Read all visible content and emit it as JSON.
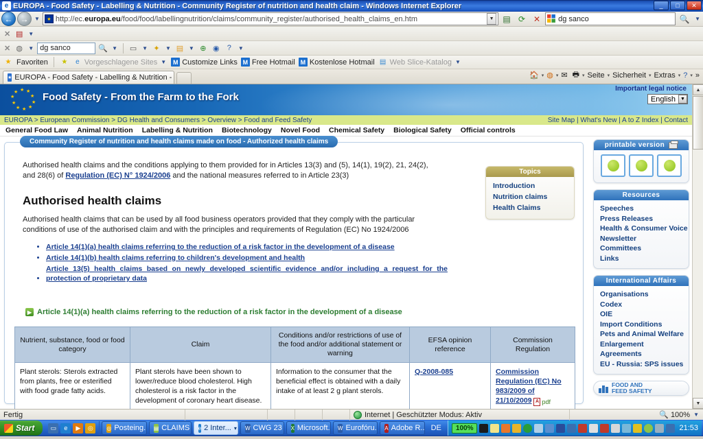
{
  "window": {
    "title": "EUROPA - Food Safety - Labelling & Nutrition - Community Register of nutrition and health claim - Windows Internet Explorer",
    "minimize": "_",
    "maximize": "□",
    "close": "✕"
  },
  "browser": {
    "url_prefix": "http://ec.",
    "url_bold": "europa.eu",
    "url_rest": "/food/food/labellingnutrition/claims/community_register/authorised_health_claims_en.htm",
    "search_value": "dg sanco",
    "toolbar_search_value": "dg sanco",
    "favorites_label": "Favoriten",
    "favorites": [
      {
        "label": "Vorgeschlagene Sites",
        "icon": "ie-icon",
        "dimmed": true
      },
      {
        "label": "Customize Links",
        "icon": "msn-icon",
        "dimmed": false
      },
      {
        "label": "Free Hotmail",
        "icon": "msn-icon",
        "dimmed": false
      },
      {
        "label": "Kostenlose Hotmail",
        "icon": "msn-icon",
        "dimmed": false
      },
      {
        "label": "Web Slice-Katalog",
        "icon": "webslice-icon",
        "dimmed": true
      }
    ],
    "tab_label": "EUROPA - Food Safety - Labelling & Nutrition - Comm...",
    "command_bar": [
      {
        "label": "",
        "icon": "home-icon"
      },
      {
        "label": "",
        "icon": "feeds-icon"
      },
      {
        "label": "",
        "icon": "mail-icon"
      },
      {
        "label": "",
        "icon": "print-icon"
      },
      {
        "label": "Seite",
        "icon": "page-menu"
      },
      {
        "label": "Sicherheit",
        "icon": "security-menu"
      },
      {
        "label": "Extras",
        "icon": "tools-menu"
      },
      {
        "label": "",
        "icon": "help-icon"
      }
    ],
    "overflow": "»"
  },
  "site": {
    "legal_notice": "Important legal notice",
    "banner_title": "Food Safety - From the Farm to the Fork",
    "language": "English",
    "breadcrumb": "EUROPA > European Commission > DG Health and Consumers > Overview > Food and Feed Safety",
    "utility_links": "Site Map | What's New | A to Z Index | Contact",
    "nav": [
      "General Food Law",
      "Animal Nutrition",
      "Labelling & Nutrition",
      "Biotechnology",
      "Novel Food",
      "Chemical Safety",
      "Biological Safety",
      "Official controls"
    ]
  },
  "main": {
    "card_title": "Community Register of nutrition and health claims made on food - Authorized health claims",
    "intro_before": "Authorised health claims and the conditions applying to them provided for in Articles 13(3) and (5), 14(1), 19(2), 21, 24(2), and 28(6) of ",
    "intro_link": "Regulation (EC) N° 1924/2006",
    "intro_after": " and the national measures referred to in Article 23(3)",
    "heading": "Authorised health claims",
    "subtext": "Authorised health claims that can be used by all food business operators provided that they comply with the particular conditions of use of the authorised claim and with the principles and requirements of Regulation (EC) No 1924/2006",
    "bullets": [
      "Article 14(1)(a) health claims referring to the reduction of a risk factor in the development of a disease",
      "Article 14(1)(b) health claims referring to children's development and health",
      "Article 13(5) health claims based on newly developed scientific evidence and/or including a request for the protection of proprietary data"
    ],
    "section_heading": "Article 14(1)(a) health claims referring to the reduction of a risk factor in the development of a disease",
    "topics": {
      "title": "Topics",
      "items": [
        "Introduction",
        "Nutrition claims",
        "Health Claims"
      ]
    }
  },
  "table": {
    "headers": [
      "Nutrient, substance, food or food category",
      "Claim",
      "Conditions and/or restrictions of use of the food and/or additional statement or warning",
      "EFSA opinion reference",
      "Commission Regulation"
    ],
    "rows": [
      {
        "nutrient": "Plant sterols: Sterols extracted from plants, free or esterified with food grade fatty acids.",
        "claim": "Plant sterols have been shown to lower/reduce blood cholesterol. High cholesterol is a risk factor in the development of coronary heart disease.",
        "conditions": "Information to the consumer that the beneficial effect is obtained with a daily intake of at least 2 g plant sterols.",
        "efsa": "Q-2008-085",
        "regulation": "Commission Regulation (EC) No 983/2009 of 21/10/2009",
        "pdf_label": "pdf"
      }
    ]
  },
  "sidebar": {
    "printable": "printable version",
    "boxes": [
      {
        "title": "Resources",
        "items": [
          "Speeches",
          "Press Releases",
          "Health & Consumer Voice Newsletter",
          "Committees",
          "Links"
        ]
      },
      {
        "title": "International Affairs",
        "items": [
          "Organisations",
          "Codex",
          "OIE",
          "Import Conditions",
          "Pets and Animal Welfare",
          "Enlargement",
          "Agreements",
          "EU - Russia: SPS issues"
        ]
      }
    ],
    "footer_button_line1": "FOOD AND",
    "footer_button_line2": "FEED SAFETY"
  },
  "status": {
    "text": "Fertig",
    "zone": "Internet | Geschützter Modus: Aktiv",
    "zoom": "100%"
  },
  "taskbar": {
    "start": "Start",
    "quick_launch": [
      "show-desktop-icon",
      "ie-icon",
      "media-player-icon",
      "outlook-icon"
    ],
    "items": [
      {
        "label": "Posteing...",
        "icon": "outlook-icon",
        "active": false
      },
      {
        "label": "CLAIMS",
        "icon": "folder-icon",
        "active": false
      },
      {
        "label": "2 Inter...",
        "icon": "ie-icon",
        "active": true,
        "caret": "▾"
      },
      {
        "label": "CWG 23 ...",
        "icon": "word-icon",
        "active": false
      },
      {
        "label": "Microsoft...",
        "icon": "excel-icon",
        "active": false
      },
      {
        "label": "Eurofóru...",
        "icon": "word-icon",
        "active": false
      },
      {
        "label": "Adobe R...",
        "icon": "acrobat-icon",
        "active": false
      }
    ],
    "lang": "DE",
    "zoom_chip": "100%",
    "clock": "21:53"
  }
}
